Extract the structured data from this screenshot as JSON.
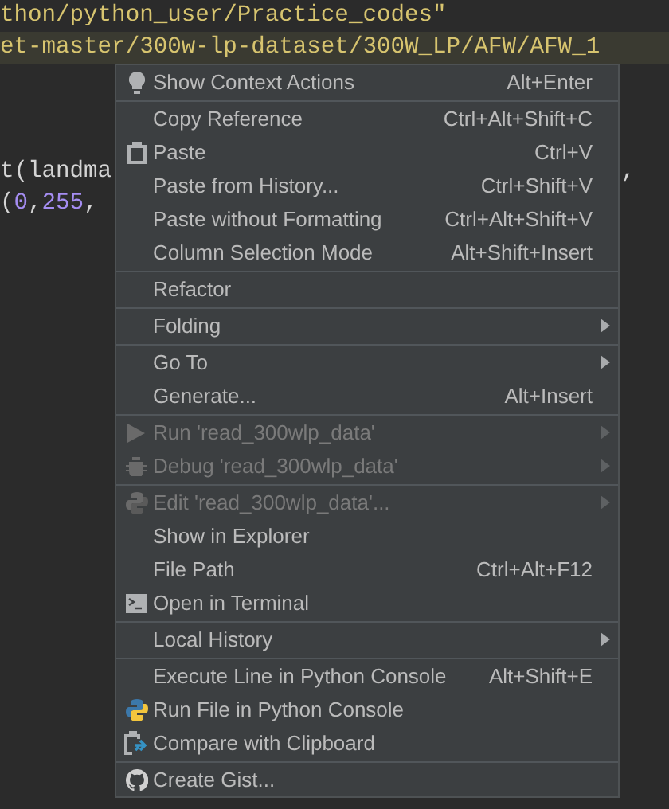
{
  "editor": {
    "lines": [
      {
        "current": false,
        "tokens": [
          {
            "text": "thon/python_user/Practice_codes\"",
            "color": "#d7c46f"
          }
        ]
      },
      {
        "current": true,
        "tokens": [
          {
            "text": "et-master/300w-lp-dataset/300W_LP/AFW/AFW_1",
            "color": "#d7c46f"
          }
        ]
      },
      {
        "current": false,
        "tokens": [
          {
            "text": "t(landma",
            "color": "#d4d4d4"
          }
        ],
        "tail": ","
      },
      {
        "current": false,
        "tokens": [
          {
            "text": "(",
            "color": "#d4d4d4"
          },
          {
            "text": "0",
            "color": "#a58df2"
          },
          {
            "text": ",",
            "color": "#d4d4d4"
          },
          {
            "text": "255",
            "color": "#a58df2"
          },
          {
            "text": ",",
            "color": "#d4d4d4"
          }
        ]
      }
    ]
  },
  "context_menu": {
    "groups": [
      [
        {
          "kind": "bulb",
          "label": "Show Context Actions",
          "shortcut": "Alt+Enter",
          "submenu": false,
          "disabled": false
        }
      ],
      [
        {
          "kind": "text",
          "label": "Copy Reference",
          "shortcut": "Ctrl+Alt+Shift+C",
          "submenu": false,
          "disabled": false
        },
        {
          "kind": "clipboard",
          "label": "Paste",
          "shortcut": "Ctrl+V",
          "submenu": false,
          "disabled": false
        },
        {
          "kind": "text",
          "label": "Paste from History...",
          "shortcut": "Ctrl+Shift+V",
          "submenu": false,
          "disabled": false
        },
        {
          "kind": "text",
          "label": "Paste without Formatting",
          "shortcut": "Ctrl+Alt+Shift+V",
          "submenu": false,
          "disabled": false
        },
        {
          "kind": "text",
          "label": "Column Selection Mode",
          "shortcut": "Alt+Shift+Insert",
          "submenu": false,
          "disabled": false
        }
      ],
      [
        {
          "kind": "text",
          "label": "Refactor",
          "submenu": false,
          "disabled": false
        }
      ],
      [
        {
          "kind": "text",
          "label": "Folding",
          "submenu": true,
          "disabled": false
        }
      ],
      [
        {
          "kind": "text",
          "label": "Go To",
          "submenu": true,
          "disabled": false
        },
        {
          "kind": "text",
          "label": "Generate...",
          "shortcut": "Alt+Insert",
          "submenu": false,
          "disabled": false
        }
      ],
      [
        {
          "kind": "play",
          "label": "Run 'read_300wlp_data'",
          "submenu": true,
          "disabled": true
        },
        {
          "kind": "bug",
          "label": "Debug 'read_300wlp_data'",
          "submenu": true,
          "disabled": true
        }
      ],
      [
        {
          "kind": "python",
          "label": "Edit 'read_300wlp_data'...",
          "submenu": true,
          "disabled": true
        },
        {
          "kind": "text",
          "label": "Show in Explorer",
          "submenu": false,
          "disabled": false
        },
        {
          "kind": "text",
          "label": "File Path",
          "shortcut": "Ctrl+Alt+F12",
          "submenu": false,
          "disabled": false
        },
        {
          "kind": "terminal",
          "label": "Open in Terminal",
          "submenu": false,
          "disabled": false
        }
      ],
      [
        {
          "kind": "text",
          "label": "Local History",
          "submenu": true,
          "disabled": false
        }
      ],
      [
        {
          "kind": "text",
          "label": "Execute Line in Python Console",
          "shortcut": "Alt+Shift+E",
          "submenu": false,
          "disabled": false
        },
        {
          "kind": "python",
          "label": "Run File in Python Console",
          "submenu": false,
          "disabled": false
        },
        {
          "kind": "compare",
          "label": "Compare with Clipboard",
          "submenu": false,
          "disabled": false
        }
      ],
      [
        {
          "kind": "github",
          "label": "Create Gist...",
          "submenu": false,
          "disabled": false
        }
      ]
    ]
  }
}
